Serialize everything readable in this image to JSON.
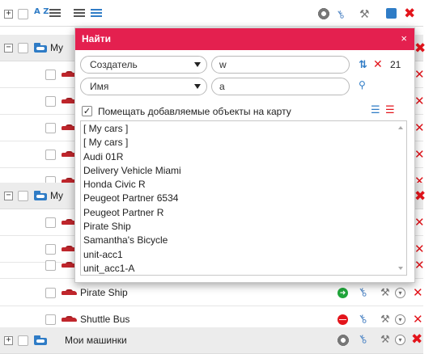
{
  "dialog": {
    "title": "Найти",
    "close_glyph": "×",
    "filter1": {
      "field": "Создатель",
      "value": "w",
      "count": "21"
    },
    "filter2": {
      "field": "Имя",
      "value": "a"
    },
    "add_to_map_label": "Помещать добавляемые объекты на карту",
    "add_to_map_checked": true,
    "results": [
      "[ My cars ]",
      "[ My cars ]",
      "Audi 01R",
      "Delivery Vehicle Miami",
      "Honda Civic R",
      "Peugeot Partner 6534",
      "Peugeot Partner R",
      "Pirate Ship",
      "Samantha's Bicycle",
      "unit-acc1",
      "unit_acc1-A"
    ]
  },
  "toolbar": {
    "sort_az": "A Z",
    "expand_sign": "⊞"
  },
  "tree": {
    "group1_partial": "My",
    "group2_partial": "My",
    "units": [
      {
        "name": "Pirate Ship",
        "status": "green"
      },
      {
        "name": "Shuttle Bus",
        "status": "red"
      }
    ],
    "bottom_group": "Мои машинки",
    "expand_glyph": "+",
    "collapse_glyph": "−"
  },
  "colors": {
    "dialog_header": "#e4204f",
    "delete_red": "#e3141b",
    "brand_blue": "#2f7cc6"
  }
}
